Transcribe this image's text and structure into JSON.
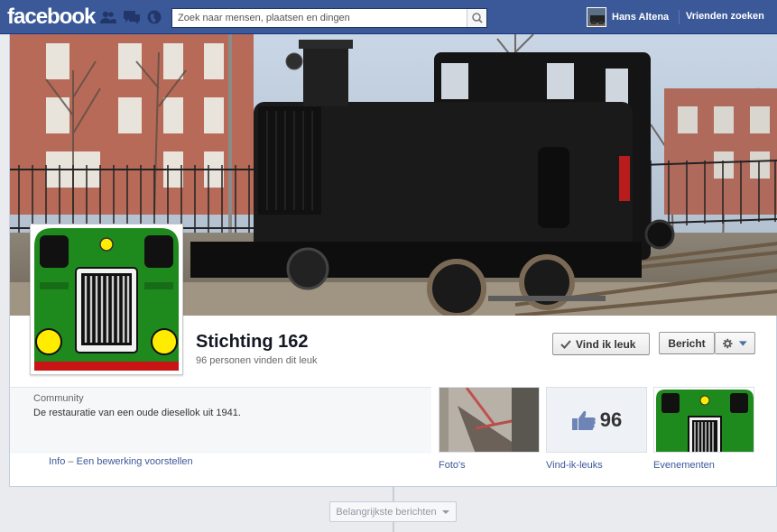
{
  "topbar": {
    "logo": "facebook",
    "search_placeholder": "Zoek naar mensen, plaatsen en dingen",
    "user_name": "Hans Altena",
    "friends_link": "Vrienden zoeken",
    "icons": [
      "friend-requests-icon",
      "messages-icon",
      "notifications-globe-icon",
      "search-icon"
    ]
  },
  "page": {
    "name": "Stichting 162",
    "likes_text": "96 personen vinden dit leuk",
    "like_button": "Vind ik leuk",
    "message_button": "Bericht",
    "gear_icon": "gear-icon",
    "category": "Community",
    "description": "De restauratie van een oude diesellok uit 1941.",
    "info_link": "Info",
    "dash": "–",
    "edit_link": "Een bewerking voorstellen"
  },
  "apps": [
    {
      "label": "Foto's",
      "icon": "photo-thumbnail"
    },
    {
      "label": "Vind-ik-leuks",
      "count": "96",
      "icon": "thumbs-up-icon"
    },
    {
      "label": "Evenementen",
      "icon": "events-thumbnail"
    }
  ],
  "timeline": {
    "filter_label": "Belangrijkste berichten"
  },
  "colors": {
    "brand": "#3b5998",
    "locomotive_green": "#1e7b1e",
    "lamp_yellow": "#ffec00"
  }
}
